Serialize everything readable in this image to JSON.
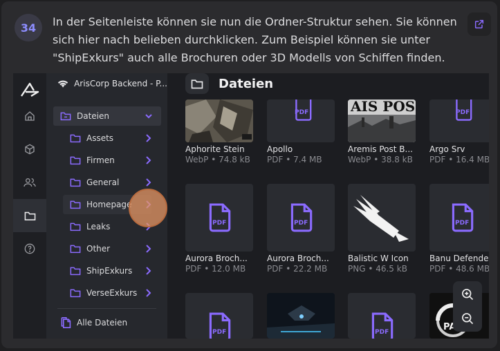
{
  "step": {
    "number": "34"
  },
  "caption": "In der Seitenleiste können sie nun die Ordner-Struktur sehen. Sie können sich hier nach belieben durchklicken. Zum Beispiel können sie unter \"ShipExkurs\" auch alle Brochuren oder 3D Modells von Schiffen finden.",
  "app": {
    "workspace_name": "ArisCorp Backend - P...",
    "nav_icons": [
      "home-icon",
      "cube-icon",
      "users-icon",
      "folder-icon",
      "help-icon"
    ],
    "active_nav": "folder-icon"
  },
  "sidebar": {
    "root_folder": "Dateien",
    "folders": [
      {
        "label": "Assets"
      },
      {
        "label": "Firmen"
      },
      {
        "label": "General"
      },
      {
        "label": "Homepage"
      },
      {
        "label": "Leaks"
      },
      {
        "label": "Other"
      },
      {
        "label": "ShipExkurs"
      },
      {
        "label": "VerseExkurs"
      }
    ],
    "all_files_label": "Alle Dateien"
  },
  "main": {
    "title": "Dateien",
    "files": [
      {
        "name": "Aphorite Stein",
        "meta": "WebP • 74.8 kB",
        "thumb": "image"
      },
      {
        "name": "Apollo",
        "meta": "PDF • 7.4 MB",
        "thumb": "pdf"
      },
      {
        "name": "Aremis Post B...",
        "meta": "WebP • 38.8 kB",
        "thumb": "image"
      },
      {
        "name": "Argo Srv",
        "meta": "PDF • 16.4 MB",
        "thumb": "pdf"
      },
      {
        "name": "Aurora Broch...",
        "meta": "PDF • 12.0 MB",
        "thumb": "pdf"
      },
      {
        "name": "Aurora Broch...",
        "meta": "PDF • 22.2 MB",
        "thumb": "pdf"
      },
      {
        "name": "Balistic W Icon",
        "meta": "PNG • 46.5 kB",
        "thumb": "image"
      },
      {
        "name": "Banu Defender",
        "meta": "PDF • 48.6 MB",
        "thumb": "pdf"
      }
    ],
    "pdf_badge": "PDF",
    "poster_text": "AIS POS",
    "party_text": "PARTY"
  },
  "colors": {
    "accent": "#8b6bff",
    "cursor": "#e6966a"
  }
}
